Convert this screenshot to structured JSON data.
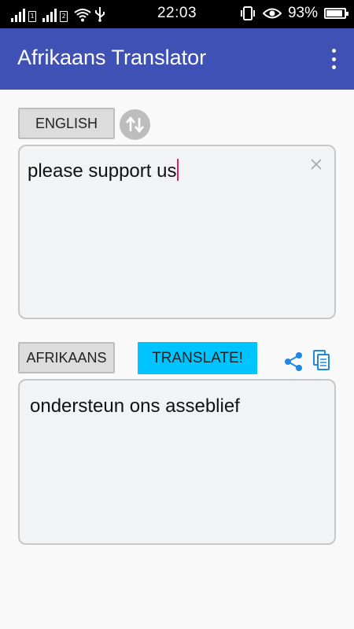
{
  "status_bar": {
    "sim1": "1",
    "sim2": "2",
    "time": "22:03",
    "battery": "93%",
    "battery_level": 0.93
  },
  "app_bar": {
    "title": "Afrikaans Translator",
    "overflow_icon": "more-vert-icon"
  },
  "source": {
    "language": "ENGLISH",
    "text": "please support us",
    "clear_icon": "close-icon"
  },
  "swap_icon": "swap-vertical-icon",
  "target": {
    "language": "AFRIKAANS",
    "translate_label": "TRANSLATE!",
    "text": "ondersteun ons asseblief",
    "share_icon": "share-icon",
    "copy_icon": "copy-icon"
  },
  "colors": {
    "app_bar": "#3f51b5",
    "translate_button": "#00c4ff",
    "icon_blue": "#1e88e5",
    "caret": "#e91e63"
  }
}
